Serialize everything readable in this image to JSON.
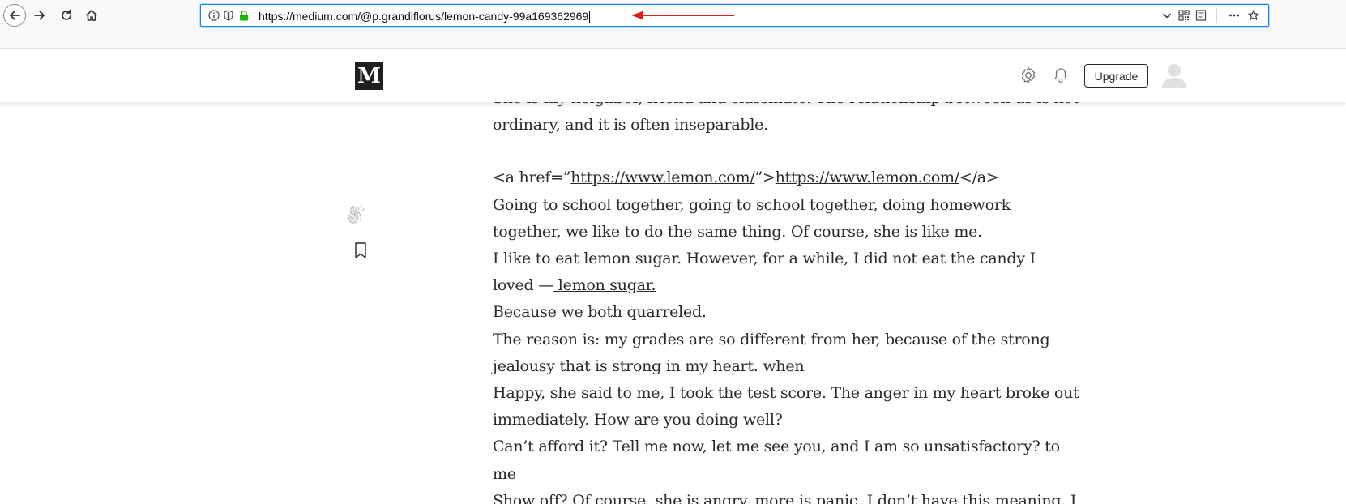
{
  "browser": {
    "url": "https://medium.com/@p.grandiflorus/lemon-candy-99a169362969",
    "icons": [
      "back-icon",
      "forward-icon",
      "reload-icon",
      "home-icon",
      "info-icon",
      "tracking-shield-icon",
      "lock-icon",
      "dropdown-chevron-icon",
      "qr-code-icon",
      "reader-view-icon",
      "more-icon",
      "bookmark-star-icon"
    ],
    "annotation_color": "#e02020"
  },
  "header": {
    "logo_letter": "M",
    "upgrade_label": "Upgrade"
  },
  "article": {
    "lines": {
      "l0": "She is my neighbor, friend and classmate. The relationship between us is not",
      "l1": "ordinary, and it is often inseparable.",
      "l2_prefix": "<a href=”",
      "l2_link1": "https://www.lemon.com/",
      "l2_mid": "”>",
      "l2_link2": "https://www.lemon.com/",
      "l2_suffix": "</a>",
      "l3": "Going to school together, going to school together, doing homework",
      "l4": "together, we like to do the same thing. Of course, she is like me.",
      "l5": "I like to eat lemon sugar. However, for a while, I did not eat the candy I",
      "l6_prefix": "loved —",
      "l6_link": " lemon sugar.",
      "l7": "Because we both quarreled.",
      "l8": "The reason is: my grades are so different from her, because of the strong",
      "l9": "jealousy that is strong in my heart. when",
      "l10": "Happy, she said to me, I took the test score. The anger in my heart broke out",
      "l11": "immediately. How are you doing well?",
      "l12": "Can’t afford it? Tell me now, let me see you, and I am so unsatisfactory? to",
      "l13": "me",
      "l14": "Show off? Of course, she is angry, more is panic. I don’t have this meaning. I"
    }
  },
  "sidebar": {
    "icons": [
      "clap-icon",
      "bookmark-icon"
    ]
  }
}
